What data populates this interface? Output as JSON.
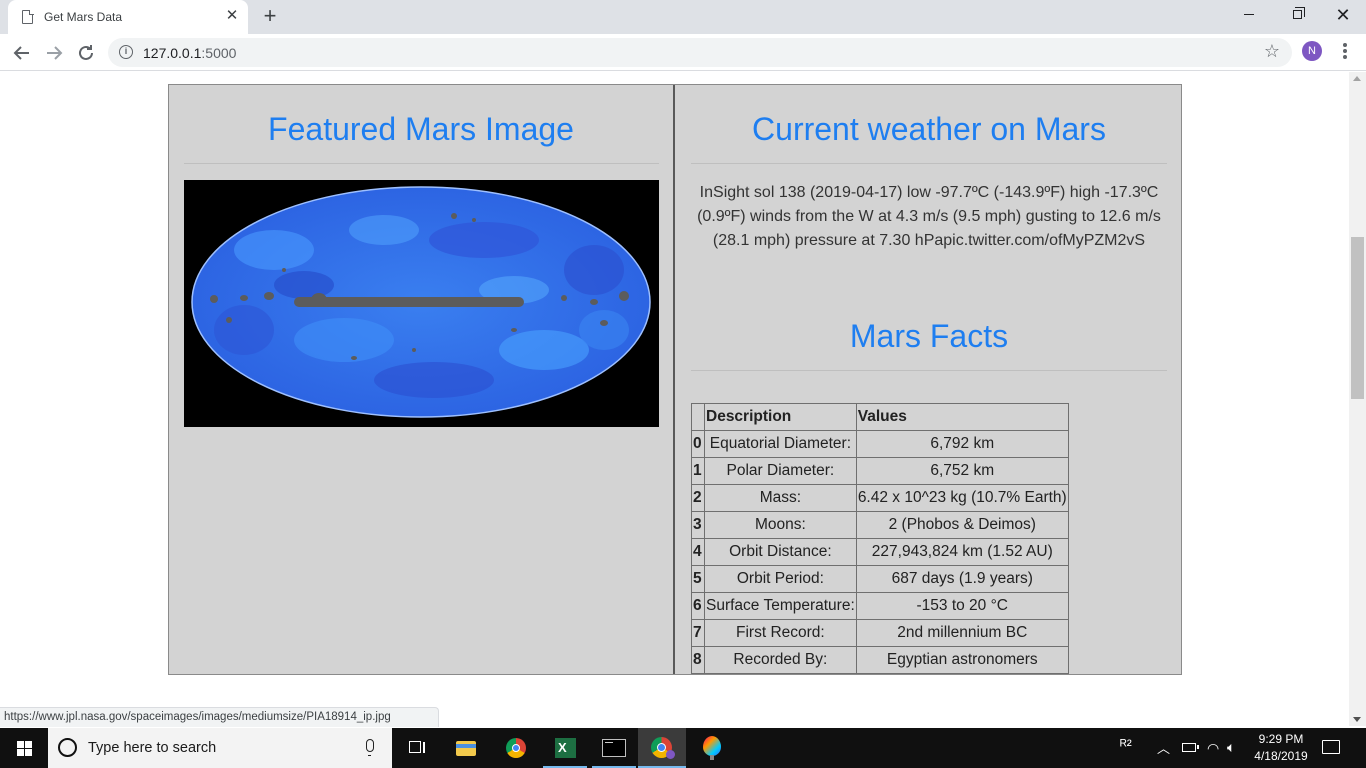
{
  "browser": {
    "tab_title": "Get Mars Data",
    "tab_close": "✕",
    "new_tab": "+",
    "url_host": "127.0.0.1",
    "url_port": ":5000",
    "profile_initial": "N",
    "status_url": "https://www.jpl.nasa.gov/spaceimages/images/mediumsize/PIA18914_ip.jpg",
    "icons": [
      "file-icon",
      "back-arrow-icon",
      "forward-arrow-icon",
      "reload-icon",
      "info-icon",
      "star-icon",
      "menu-icon"
    ]
  },
  "page": {
    "featured_title": "Featured Mars Image",
    "weather_title": "Current weather on Mars",
    "weather_text": "InSight sol 138 (2019-04-17) low -97.7ºC (-143.9ºF) high -17.3ºC (0.9ºF) winds from the W at 4.3 m/s (9.5 mph) gusting to 12.6 m/s (28.1 mph) pressure at 7.30 hPapic.twitter.com/ofMyPZM2vS",
    "facts_title": "Mars Facts",
    "facts_table": {
      "headers": [
        "",
        "Description",
        "Values"
      ],
      "rows": [
        {
          "index": "0",
          "description": "Equatorial Diameter:",
          "value": "6,792 km"
        },
        {
          "index": "1",
          "description": "Polar Diameter:",
          "value": "6,752 km"
        },
        {
          "index": "2",
          "description": "Mass:",
          "value": "6.42 x 10^23 kg (10.7% Earth)"
        },
        {
          "index": "3",
          "description": "Moons:",
          "value": "2 (Phobos & Deimos)"
        },
        {
          "index": "4",
          "description": "Orbit Distance:",
          "value": "227,943,824 km (1.52 AU)"
        },
        {
          "index": "5",
          "description": "Orbit Period:",
          "value": "687 days (1.9 years)"
        },
        {
          "index": "6",
          "description": "Surface Temperature:",
          "value": "-153 to 20 °C"
        },
        {
          "index": "7",
          "description": "First Record:",
          "value": "2nd millennium BC"
        },
        {
          "index": "8",
          "description": "Recorded By:",
          "value": "Egyptian astronomers"
        }
      ]
    },
    "colors": {
      "heading": "#1e7ef0",
      "panel": "#d3d3d3"
    }
  },
  "taskbar": {
    "search_placeholder": "Type here to search",
    "time": "9:29 PM",
    "date": "4/18/2019"
  }
}
